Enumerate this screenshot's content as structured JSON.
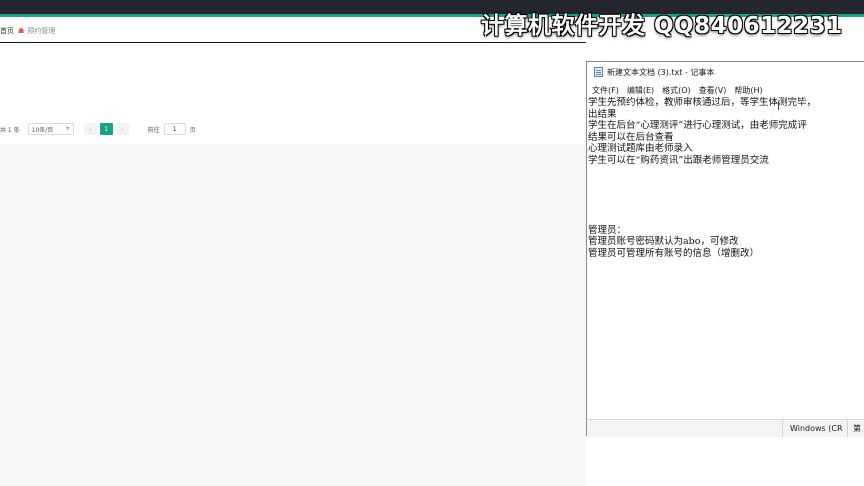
{
  "watermark": "计算机软件开发 QQ840612231",
  "breadcrumb": {
    "home": "首页",
    "current": "预约管理"
  },
  "pagination": {
    "total": "共 1 条",
    "page_size": "10条/页",
    "prev": "‹",
    "current_page": "1",
    "next": "›",
    "goto_label": "前往",
    "goto_value": "1",
    "goto_suffix": "页"
  },
  "notepad": {
    "title": "新建文本文档 (3).txt - 记事本",
    "menu": [
      "文件(F)",
      "编辑(E)",
      "格式(O)",
      "查看(V)",
      "帮助(H)"
    ],
    "lines": [
      "学生先预约体检，教师审核通过后，等学生体测完毕，",
      "出结果",
      "学生在后台“心理测评”进行心理测试，由老师完成评",
      "结果可以在后台查看",
      "心理测试题库由老师录入",
      "学生可以在“购药资讯”出跟老师管理员交流",
      "",
      "",
      "",
      "",
      "",
      "管理员：",
      "管理员账号密码默认为abo，可修改",
      "管理员可管理所有账号的信息（增删改）"
    ],
    "status_encoding": "Windows (CR",
    "status_position": "第"
  },
  "colors": {
    "accent": "#16a389",
    "topbar": "#23262e"
  },
  "icons": {
    "home": "home-icon",
    "notepad": "notepad-icon"
  }
}
